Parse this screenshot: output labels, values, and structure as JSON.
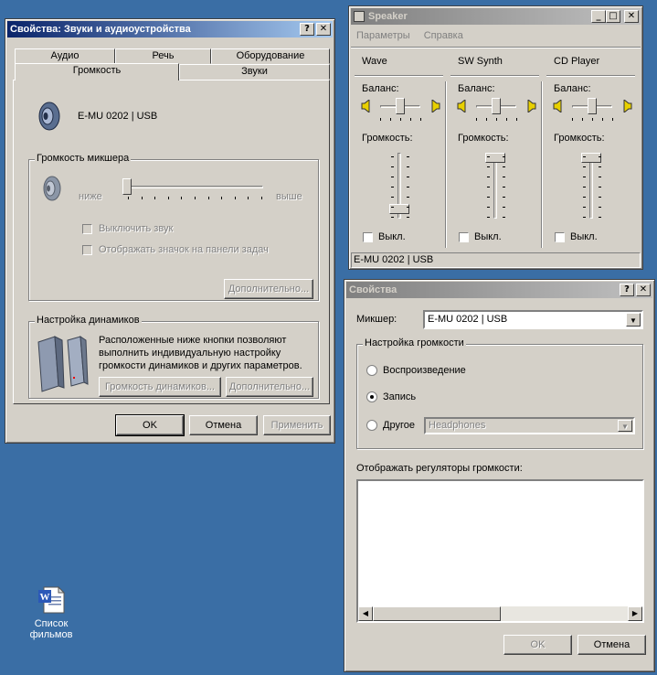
{
  "sound_props": {
    "title": "Свойства: Звуки и аудиоустройства",
    "tabs_row1": [
      "Аудио",
      "Речь",
      "Оборудование"
    ],
    "tabs_row2": [
      "Громкость",
      "Звуки"
    ],
    "device_name": "E-MU 0202 | USB",
    "mixer_group": "Громкость микшера",
    "low_label": "ниже",
    "high_label": "выше",
    "volume_level": 0,
    "mute_label": "Выключить звук",
    "tray_label": "Отображать значок на панели задач",
    "advanced_label": "Дополнительно...",
    "speaker_group": "Настройка динамиков",
    "speaker_desc": "Расположенные ниже кнопки позволяют выполнить индивидуальную настройку громкости динамиков и других параметров.",
    "speaker_volume_btn": "Громкость динамиков...",
    "speaker_advanced_btn": "Дополнительно...",
    "ok": "OK",
    "cancel": "Отмена",
    "apply": "Применить"
  },
  "speaker": {
    "title": "Speaker",
    "menu": [
      "Параметры",
      "Справка"
    ],
    "balance_label": "Баланс:",
    "volume_label": "Громкость:",
    "mute_label": "Выкл.",
    "channels": [
      {
        "name": "Wave",
        "balance": 0.5,
        "volume": 0.1
      },
      {
        "name": "SW Synth",
        "balance": 0.5,
        "volume": 1.0
      },
      {
        "name": "CD Player",
        "balance": 0.5,
        "volume": 1.0
      }
    ],
    "status": "E-MU 0202 | USB"
  },
  "props": {
    "title": "Свойства",
    "mixer_label": "Микшер:",
    "mixer_value": "E-MU 0202 | USB",
    "volume_group": "Настройка громкости",
    "playback": "Воспроизведение",
    "record": "Запись",
    "other": "Другое",
    "other_value": "Headphones",
    "show_label": "Отображать регуляторы громкости:",
    "ok": "OK",
    "cancel": "Отмена"
  },
  "desktop": {
    "icon_label_1": "Список",
    "icon_label_2": "фильмов"
  },
  "colors": {
    "desktop": "#3a6ea5",
    "face": "#d4d0c8",
    "title_active": "#0a246a"
  }
}
